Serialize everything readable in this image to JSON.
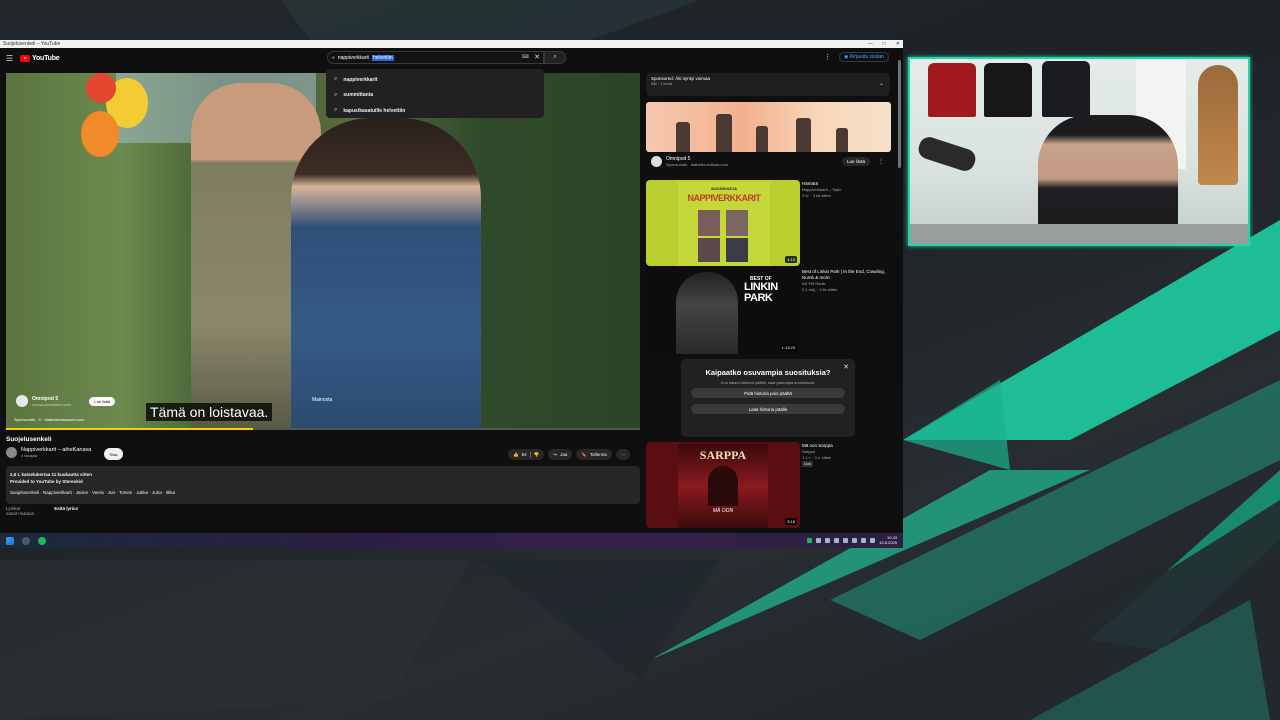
{
  "window": {
    "title": "Suojelusenkeli – YouTube",
    "controls": [
      "—",
      "□",
      "✕"
    ]
  },
  "youtube": {
    "logo": "YouTube",
    "search": {
      "value": "nappiverkkarit",
      "selected_suffix": "helvettiin"
    },
    "sign_in": "Kirjaudu sisään",
    "suggestions": [
      "nappiverkkarit",
      "summittanta",
      "kapusikasatuille helvettiin"
    ]
  },
  "video": {
    "subtitle": "Tämä on loistavaa.",
    "sponsor_name": "Omnipod 5",
    "sponsor_url": "omnipodantoinen.com",
    "sponsor_button": "Lue lisää",
    "sponsor_line": "Sponsoroitu · 0 · diabetesinsuosee.com",
    "badge": "Mainosta",
    "progress": 0.39,
    "title": "Suojelusenkeli",
    "channel": "Nappiverkkarit – aiheKanava",
    "subscribers": "4 tilaajaa",
    "subscribe": "Tilaa",
    "likes": "64",
    "share": "Jaa",
    "save": "Tallenna",
    "desc_line1": "2,6 t. katselukertaa  11 kuukautta sitten",
    "desc_line2": "Provided to YouTube by Stereokid",
    "desc_line3": "Suojelusenkeli · Nappiverkkarit · Janne · Veera · Juri · Tommi · Jukka · Juha · Ilkka",
    "lyrics_label": "Lyriikat",
    "lyrics_sub": "sanat mukaan",
    "lyrics_link": "Esitä lyrics"
  },
  "sidebar": {
    "ad_header": "Sponsored: Äiti syntyi voimaa",
    "ad_sub": "Äiti · 1 kerta",
    "ad_name": "Omnipod 5",
    "ad_meta": "Sponsoroitu · diabetes.tuttuna.com",
    "ad_button": "Lue lisää",
    "items": [
      {
        "title": "Hämärä",
        "channel": "Nappiverkkarit – Topic",
        "meta": "2 tv. · 3 kk sitten",
        "duration": "4:15",
        "thumb_text": "NAPPIVERKKARIT",
        "thumb_text2": "SUOSIKKEJA"
      },
      {
        "title": "Best of Linkin Park | In the End, Crawling, Numb & more",
        "channel": "AK FM Radio",
        "meta": "2,1 milj. · 2 kk sitten",
        "duration": "1:13:23",
        "thumb_text": "BEST OF",
        "thumb_text2": "LINKIN PARK"
      },
      {
        "title": "Mä oon Sarppa",
        "channel": "Sarppa",
        "meta": "1,1 t. · 3 v. sitten",
        "duration": "3:18",
        "tag": "Uusi",
        "thumb_text": "SARPPA",
        "thumb_text2": "MÄ OON"
      }
    ],
    "popup": {
      "title": "Kaipaatko osuvampia suosituksia?",
      "text": "Kun katsot historia päällä, saat parempia suosituksia.",
      "button1": "Pidä historia pois päältä",
      "button2": "Laita historia päälle"
    }
  },
  "taskbar": {
    "time": "10.33",
    "date": "13.5.2025"
  },
  "colors": {
    "accent": "#1fd7a8",
    "youtube_red": "#ff0000",
    "progress": "#ffcc00"
  }
}
